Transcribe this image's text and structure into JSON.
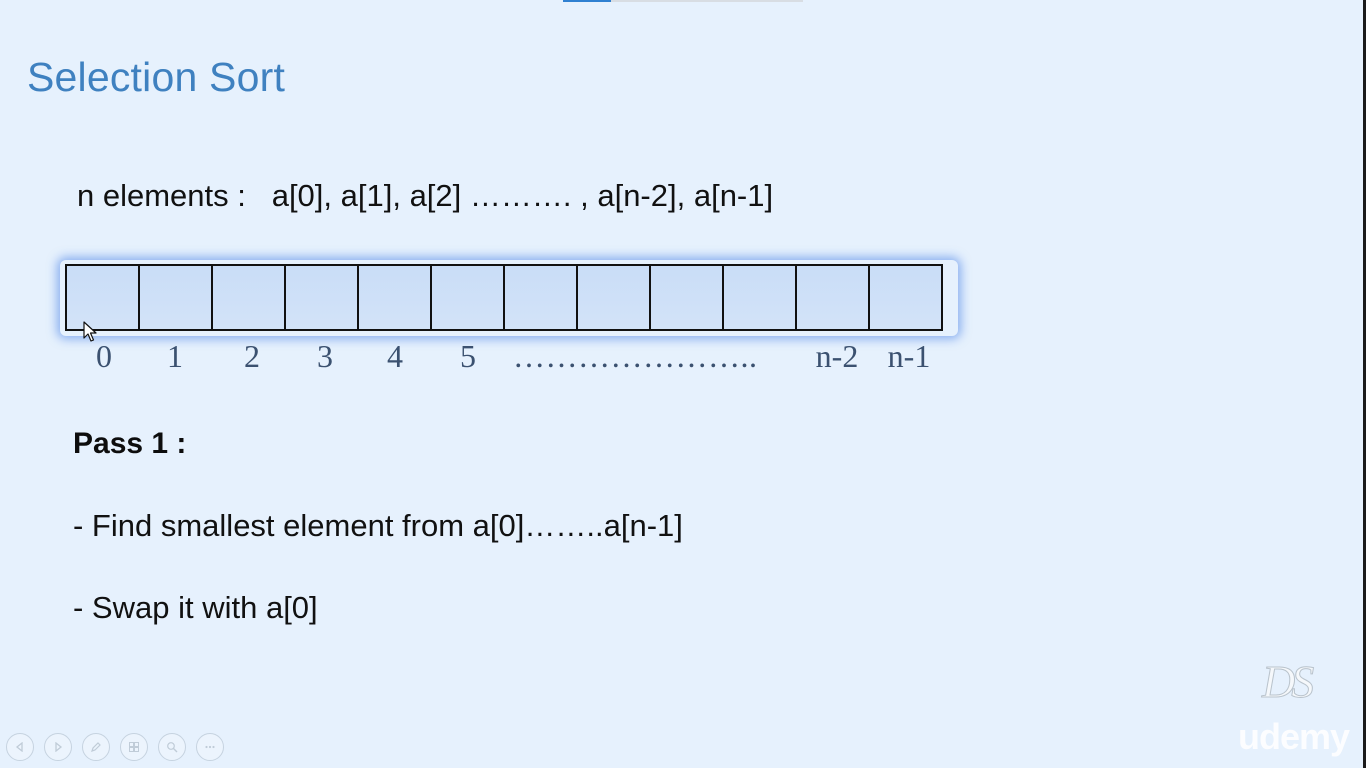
{
  "slide": {
    "title": "Selection Sort",
    "elements_line": "n elements :   a[0], a[1], a[2] ………. , a[n-2], a[n-1]",
    "array": {
      "cell_count": 12,
      "indices": [
        "0",
        "1",
        "2",
        "3",
        "4",
        "5",
        "n-2",
        "n-1"
      ],
      "dots": "…………………..",
      "highlight_color": "#3c78e6"
    },
    "pass_heading": "Pass 1 :",
    "steps": [
      "- Find smallest element from a[0]……..a[n-1]",
      "- Swap it with a[0]"
    ]
  },
  "watermarks": {
    "logo_text": "DS",
    "brand_text": "udemy"
  },
  "controls": {
    "icons": [
      "previous-icon",
      "next-icon",
      "pen-icon",
      "slides-icon",
      "zoom-icon",
      "more-icon"
    ]
  },
  "colors": {
    "background": "#e6f1fd",
    "title": "#3f81c0",
    "index_text": "#3b5170"
  }
}
